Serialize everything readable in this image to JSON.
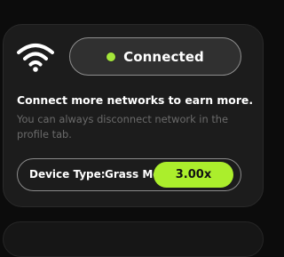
{
  "status": {
    "label": "Connected",
    "dot_color": "#a4e63a"
  },
  "icons": {
    "wifi": "wifi-icon"
  },
  "info": {
    "headline": "Connect more networks to earn more.",
    "subtext": "You can always disconnect network in the profile tab."
  },
  "device": {
    "label": "Device Type:",
    "value": "Grass Mobile",
    "multiplier": "3.00x",
    "accent_color": "#abee2c"
  }
}
